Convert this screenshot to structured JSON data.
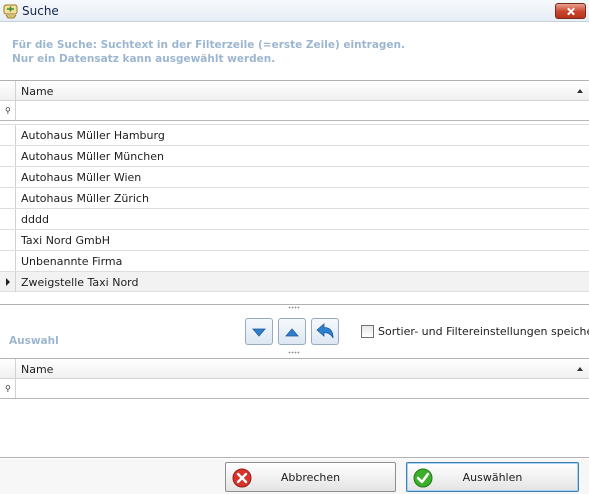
{
  "window": {
    "title": "Suche",
    "close_icon": "close-icon"
  },
  "hint": {
    "line1": "Für die Suche: Suchtext in der Filterzeile (=erste Zeile) eintragen.",
    "line2": "Nur ein Datensatz kann ausgewählt werden."
  },
  "search_grid": {
    "column": "Name",
    "filter_value": "",
    "rows": [
      "Autohaus Müller Hamburg",
      "Autohaus Müller München",
      "Autohaus Müller Wien",
      "Autohaus Müller Zürich",
      "dddd",
      "Taxi Nord GmbH",
      "Unbenannte Firma",
      "Zweigstelle Taxi Nord"
    ],
    "current_row": "Zweigstelle Taxi Nord"
  },
  "selection": {
    "label": "Auswahl",
    "column": "Name",
    "filter_value": ""
  },
  "toolbar": {
    "add_icon": "arrow-down-icon",
    "remove_icon": "arrow-up-icon",
    "reset_icon": "undo-arrow-icon",
    "save_settings_label": "Sortier- und Filtereinstellungen speichern",
    "save_settings_checked": false
  },
  "buttons": {
    "cancel_label": "Abbrechen",
    "confirm_label": "Auswählen"
  },
  "colors": {
    "hint_text": "#9db6d0",
    "accent_blue": "#2f7fcf",
    "cancel_red": "#d8322b",
    "confirm_green": "#3caf2d"
  }
}
